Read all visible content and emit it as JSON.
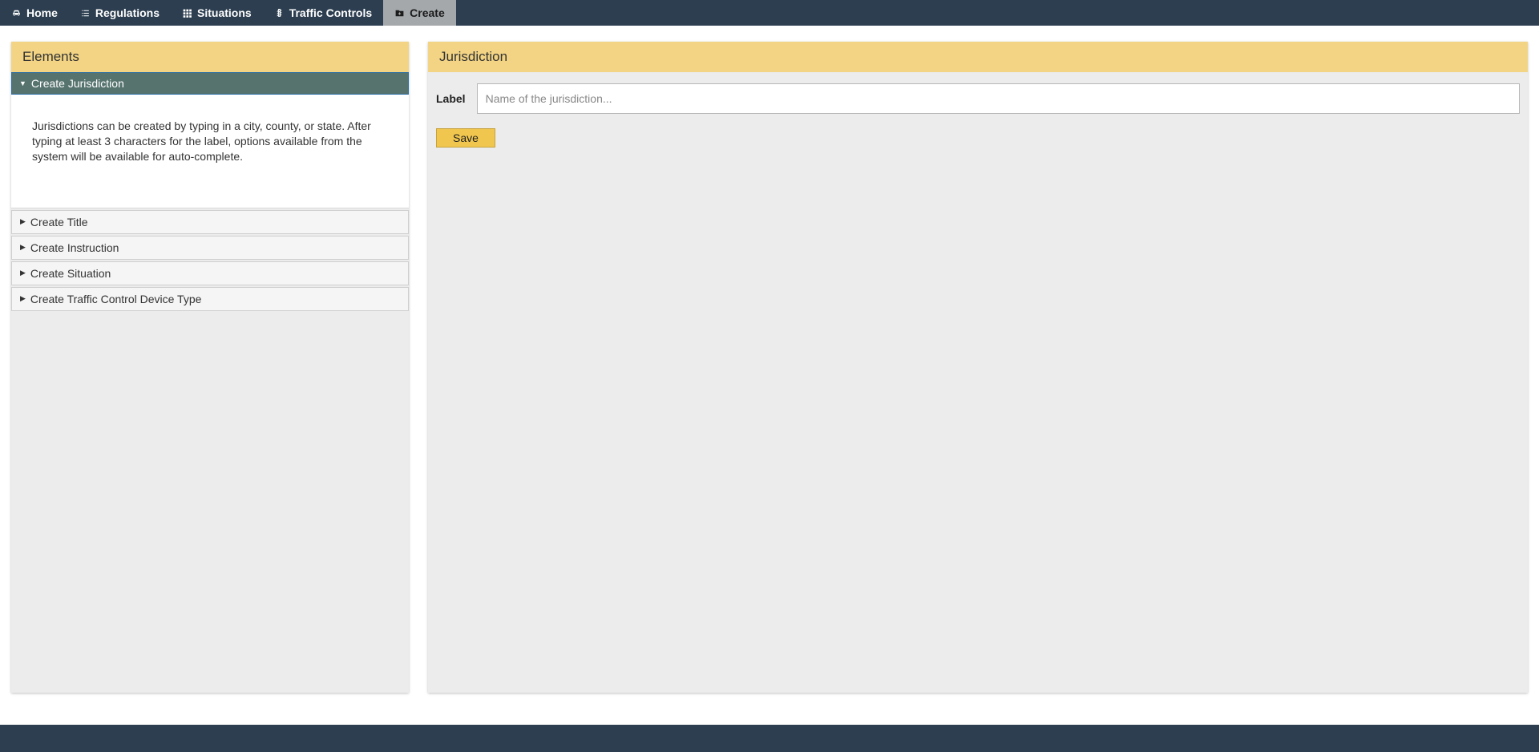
{
  "nav": {
    "items": [
      {
        "label": "Home",
        "icon": "car-icon",
        "active": false
      },
      {
        "label": "Regulations",
        "icon": "list-icon",
        "active": false
      },
      {
        "label": "Situations",
        "icon": "grid-icon",
        "active": false
      },
      {
        "label": "Traffic Controls",
        "icon": "traffic-icon",
        "active": false
      },
      {
        "label": "Create",
        "icon": "folder-icon",
        "active": true
      }
    ]
  },
  "elements_panel": {
    "title": "Elements",
    "items": [
      {
        "label": "Create Jurisdiction",
        "active": true,
        "body": "Jurisdictions can be created by typing in a city, county, or state. After typing at least 3 characters for the label, options available from the system will be available for auto-complete."
      },
      {
        "label": "Create Title",
        "active": false
      },
      {
        "label": "Create Instruction",
        "active": false
      },
      {
        "label": "Create Situation",
        "active": false
      },
      {
        "label": "Create Traffic Control Device Type",
        "active": false
      }
    ]
  },
  "jurisdiction_panel": {
    "title": "Jurisdiction",
    "field_label": "Label",
    "placeholder": "Name of the jurisdiction...",
    "value": "",
    "save_label": "Save"
  }
}
